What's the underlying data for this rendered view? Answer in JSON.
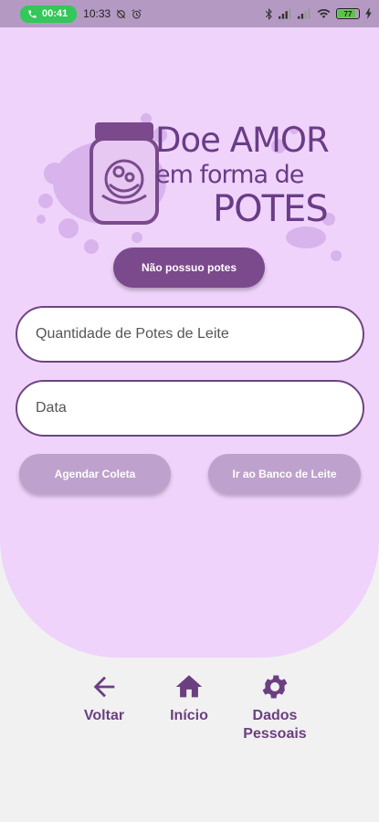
{
  "status_bar": {
    "call_timer": "00:41",
    "time": "10:33",
    "battery_level": "77",
    "icons": [
      "phone-icon",
      "sync-off-icon",
      "alarm-icon",
      "bluetooth-icon",
      "signal-icon",
      "signal-icon",
      "wifi-icon",
      "battery-icon",
      "charging-icon"
    ]
  },
  "logo": {
    "line1": "Doe AMOR",
    "line2": "em forma de",
    "line3": "POTES"
  },
  "buttons": {
    "no_jars": "Não possuo potes",
    "schedule": "Agendar Coleta",
    "milk_bank": "Ir ao Banco de Leite"
  },
  "form": {
    "quantity_placeholder": "Quantidade de Potes de Leite",
    "date_placeholder": "Data"
  },
  "nav": {
    "back": "Voltar",
    "home": "Início",
    "personal_data_line1": "Dados",
    "personal_data_line2": "Pessoais"
  },
  "colors": {
    "status_bar": "#b49ac2",
    "panel": "#efd3fb",
    "accent": "#7a4a8c",
    "secondary_button": "#bea1cc",
    "nav_icon": "#6b3f80",
    "background": "#f1f1f1"
  }
}
